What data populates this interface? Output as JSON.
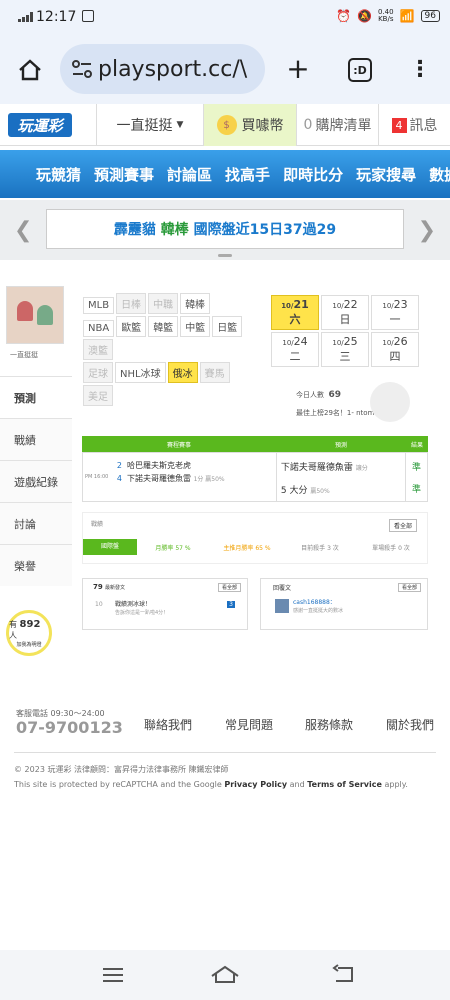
{
  "status": {
    "time": "12:17",
    "speed": "0.40",
    "speed_unit": "KB/s",
    "battery": "96"
  },
  "browser": {
    "url": "playsport.cc/\\",
    "tab_label": ":D"
  },
  "site": {
    "logo": "玩運彩",
    "dropdown": "一直挺挺",
    "coin_label": "買噱幣",
    "cart_count": "0",
    "cart_label": "購牌清單",
    "msg_count": "4",
    "msg_label": "訊息"
  },
  "nav": [
    "玩競猜",
    "預測賽事",
    "討論區",
    "找高手",
    "即時比分",
    "玩家搜尋",
    "數據"
  ],
  "marquee": {
    "part1": "霹靂貓",
    "part2": "韓棒",
    "part3": "國際盤近15日37過29"
  },
  "profile": {
    "name": "一直挺挺"
  },
  "sidebar": [
    "預測",
    "戰績",
    "遊戲紀錄",
    "討論",
    "榮譽"
  ],
  "leagues": [
    {
      "label": "MLB",
      "state": "normal"
    },
    {
      "label": "日棒",
      "state": "dim"
    },
    {
      "label": "中職",
      "state": "dim"
    },
    {
      "label": "韓棒",
      "state": "normal"
    },
    {
      "label": "NBA",
      "state": "normal"
    },
    {
      "label": "歐籃",
      "state": "normal"
    },
    {
      "label": "韓籃",
      "state": "normal"
    },
    {
      "label": "中籃",
      "state": "normal"
    },
    {
      "label": "日籃",
      "state": "normal"
    },
    {
      "label": "澳籃",
      "state": "dim"
    },
    {
      "label": "足球",
      "state": "dim"
    },
    {
      "label": "NHL冰球",
      "state": "normal"
    },
    {
      "label": "俄冰",
      "state": "sel"
    },
    {
      "label": "賽馬",
      "state": "dim"
    },
    {
      "label": "美足",
      "state": "dim"
    }
  ],
  "dates": [
    {
      "m": "10/",
      "d": "21 六",
      "sel": true
    },
    {
      "m": "10/",
      "d": "22 日",
      "sel": false
    },
    {
      "m": "10/",
      "d": "23 一",
      "sel": false
    },
    {
      "m": "10/",
      "d": "24 二",
      "sel": false
    },
    {
      "m": "10/",
      "d": "25 三",
      "sel": false
    },
    {
      "m": "10/",
      "d": "26 四",
      "sel": false
    }
  ],
  "today": {
    "label": "今日人數",
    "value": "69",
    "rank": "最佳上榜29名！1-  ntomd"
  },
  "game": {
    "headers": [
      "賽程賽事",
      "預測",
      "結果"
    ],
    "time": "PM 16:00",
    "team1_no": "2",
    "team1": "哈巴羅夫斯克老虎",
    "team2_no": "4",
    "team2": "下諾夫哥羅德魚雷",
    "line": "1分 贏50%",
    "pick1": "下諾夫哥羅德魚雷",
    "pick1_note": "讓分",
    "pick2": "5 大分",
    "pick2_note": "贏50%",
    "res1": "準",
    "res2": "準"
  },
  "trend": {
    "title": "戰績",
    "more": "看全部",
    "items": [
      "國際盤",
      "月勝率 57 %",
      "主推月勝率 65 %",
      "目前殺手 3 次",
      "單場殺手 0 次"
    ]
  },
  "posts": {
    "count": "79",
    "label": "最新發文",
    "more": "看全部",
    "item_no": "10",
    "item_title": "戰績測冰球！",
    "item_sub": "告訴你這是一趴啦4分！",
    "item_badge": "3"
  },
  "replies": {
    "label": "回覆文",
    "more": "看全部",
    "user": "cash168888：",
    "text": "感謝一直挺挺大的數冰"
  },
  "bulb": {
    "prefix": "有",
    "count": "892",
    "suffix": "人",
    "sub": "加我為明燈"
  },
  "footer": {
    "hotline_label": "客服電話 09:30～24:00",
    "phone": "07-9700123",
    "links": [
      "聯絡我們",
      "常見問題",
      "服務條款",
      "關於我們"
    ],
    "copyright": "© 2023 玩運彩  法律顧問：富昇得力法律事務所 陳鐵宏律師",
    "recaptcha": "This site is protected by reCAPTCHA and the Google",
    "pp": "Privacy Policy",
    "and": "and",
    "tos": "Terms of Service",
    "apply": "apply."
  }
}
